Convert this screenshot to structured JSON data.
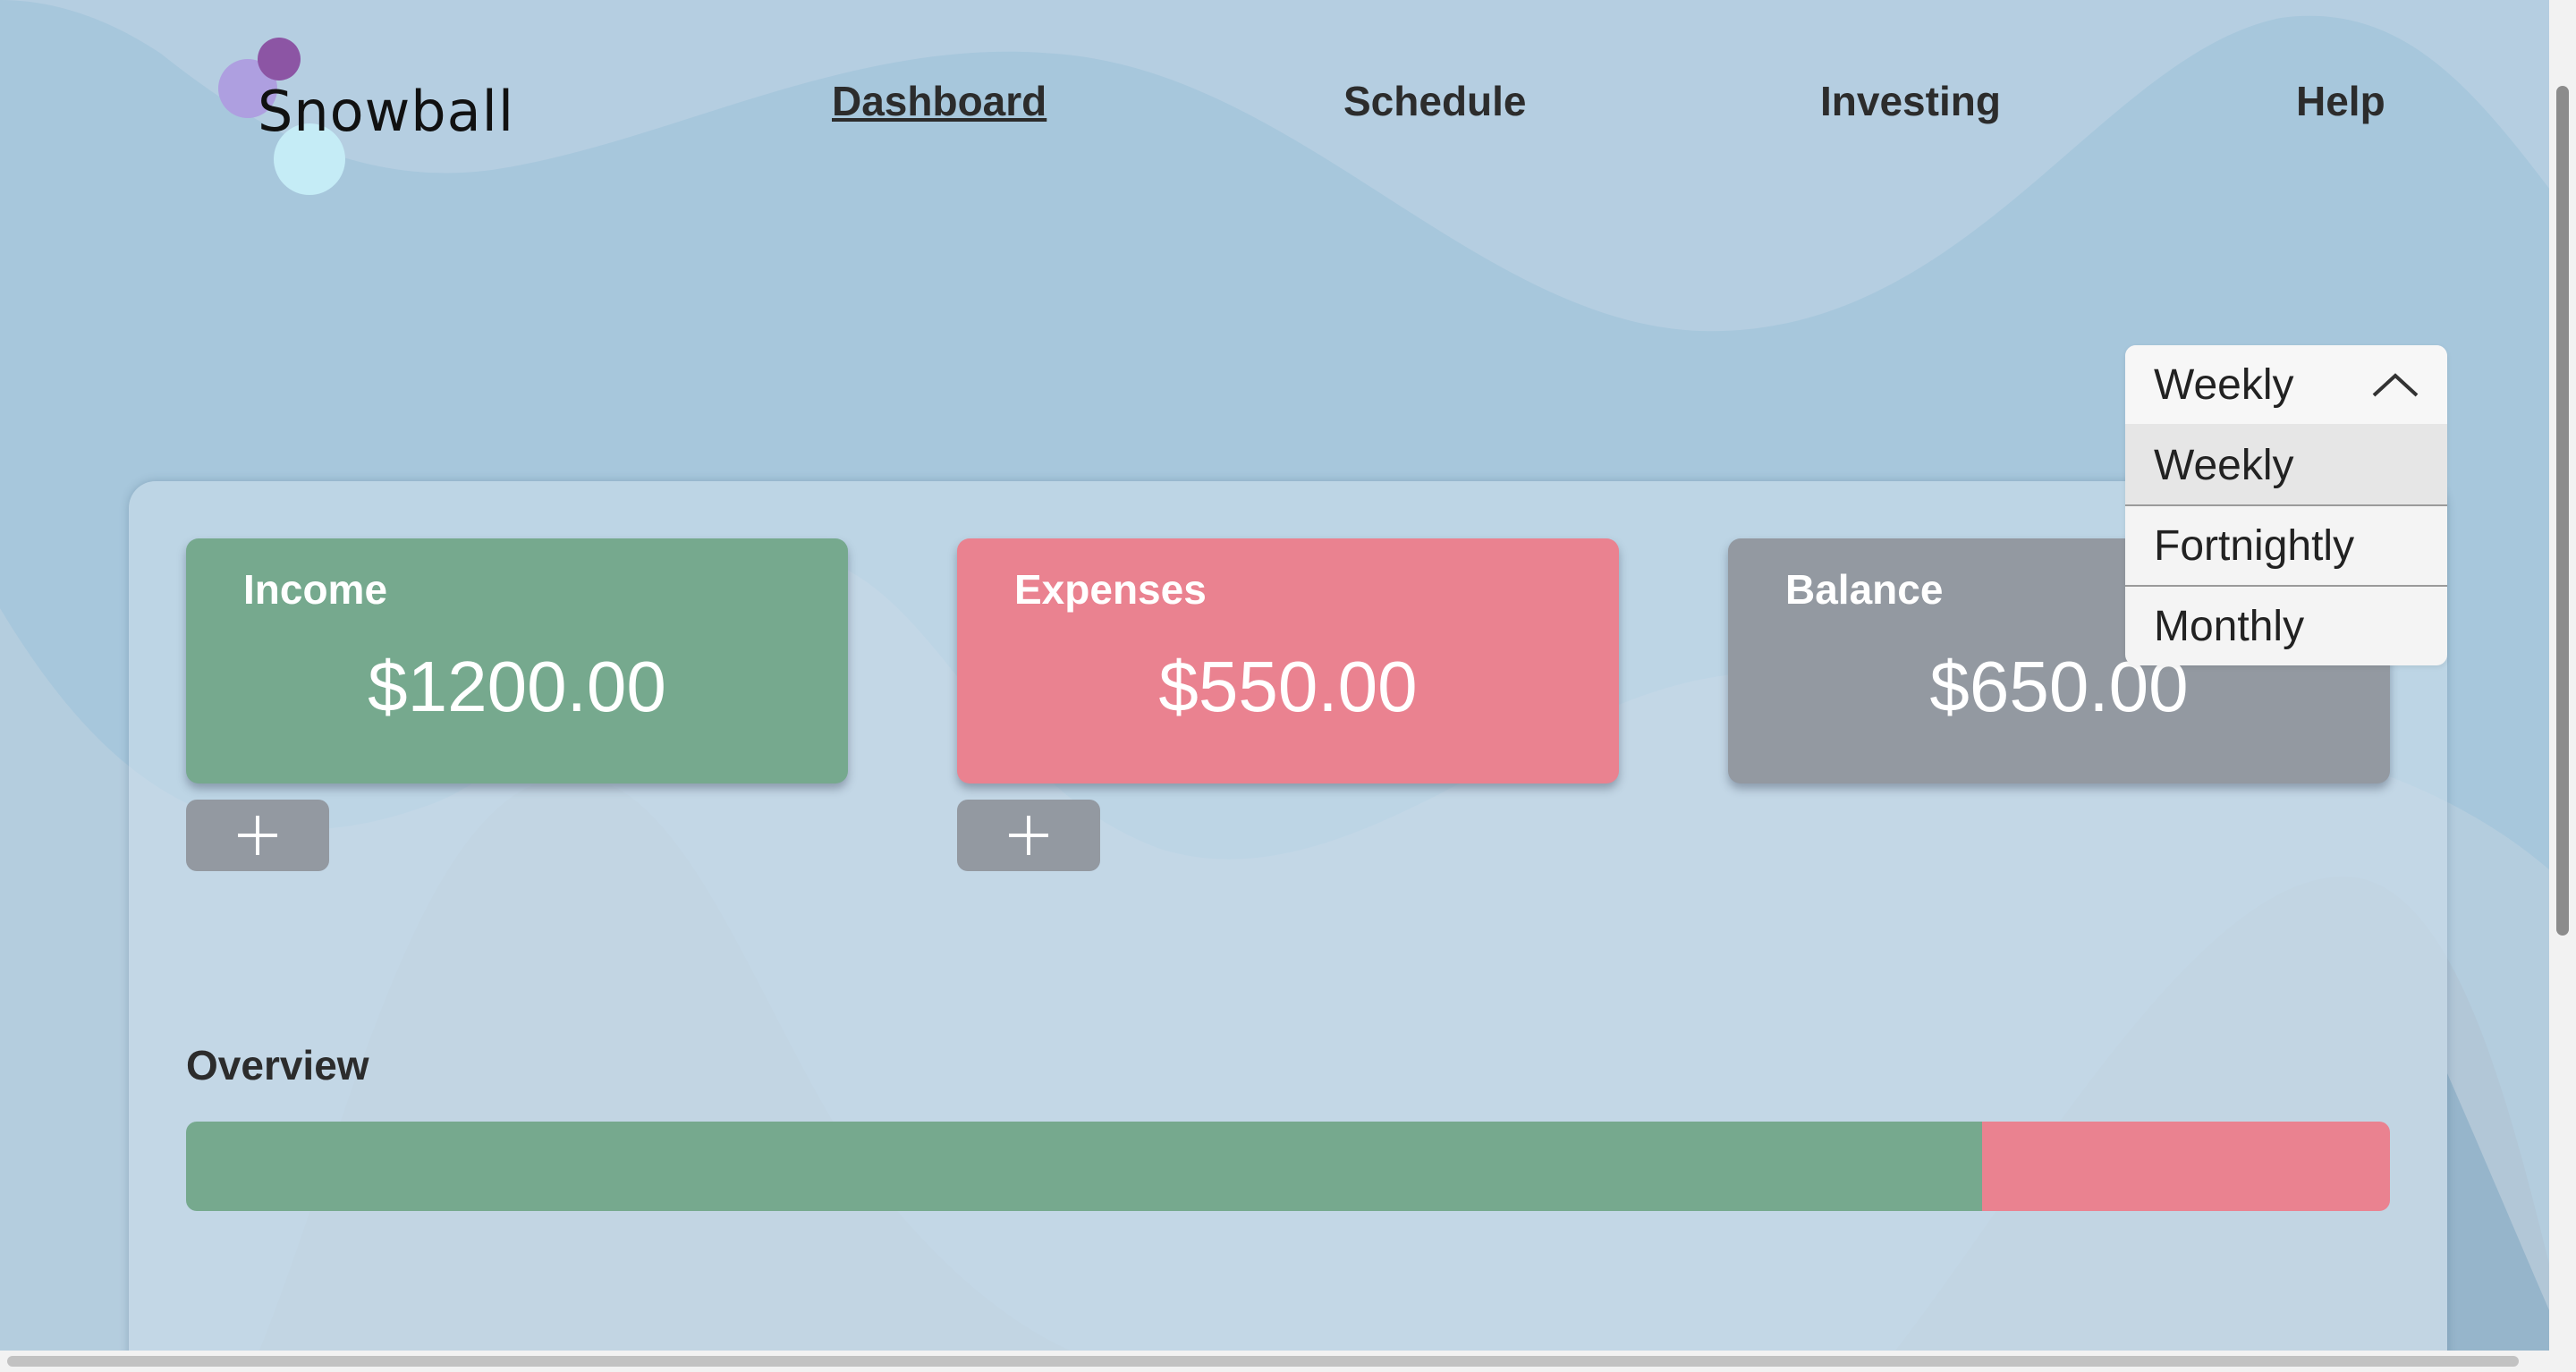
{
  "brand": {
    "name": "Snowball"
  },
  "nav": {
    "dashboard": "Dashboard",
    "schedule": "Schedule",
    "investing": "Investing",
    "help": "Help"
  },
  "period_select": {
    "selected": "Weekly",
    "options": [
      "Weekly",
      "Fortnightly",
      "Monthly"
    ],
    "highlighted": "Weekly"
  },
  "cards": {
    "income": {
      "title": "Income",
      "amount": "$1200.00",
      "color": "#76a98e"
    },
    "expenses": {
      "title": "Expenses",
      "amount": "$550.00",
      "color": "#ea8290"
    },
    "balance": {
      "title": "Balance",
      "amount": "$650.00",
      "color": "#9399a1"
    }
  },
  "add_buttons": {
    "icon": "plus-icon"
  },
  "overview": {
    "label": "Overview",
    "income_fraction": 0.8148,
    "expenses_fraction": 0.1852
  }
}
